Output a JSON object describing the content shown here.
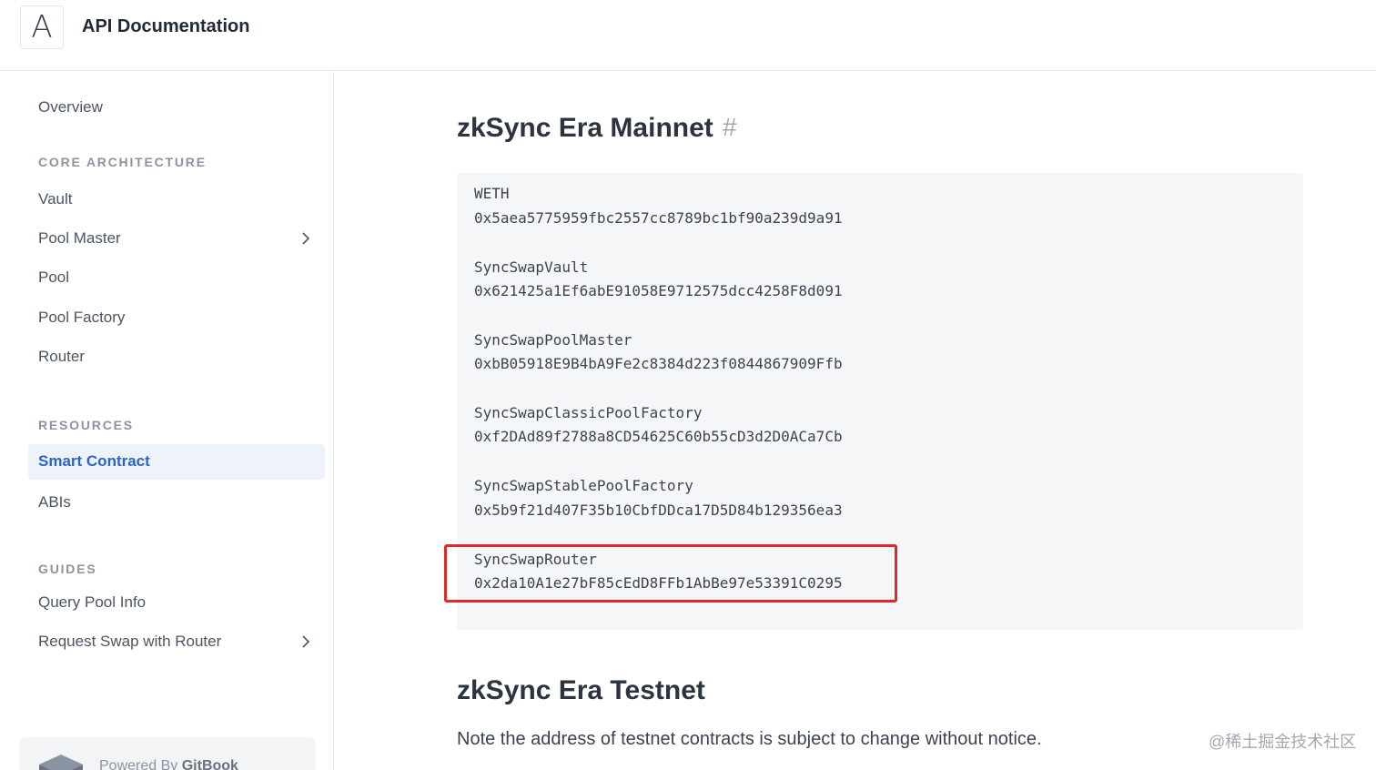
{
  "header": {
    "logo_letter": "A",
    "title": "API Documentation"
  },
  "sidebar": {
    "overview": "Overview",
    "sections": [
      {
        "title": "CORE ARCHITECTURE"
      },
      {
        "title": "RESOURCES"
      },
      {
        "title": "GUIDES"
      }
    ],
    "items": {
      "vault": "Vault",
      "pool_master": "Pool Master",
      "pool": "Pool",
      "pool_factory": "Pool Factory",
      "router": "Router",
      "smart_contract": "Smart Contract",
      "abis": "ABIs",
      "query_pool_info": "Query Pool Info",
      "request_swap": "Request Swap with Router"
    },
    "powered_by_prefix": "Powered By ",
    "powered_by_brand": "GitBook"
  },
  "main": {
    "mainnet_heading": "zkSync Era Mainnet",
    "anchor_symbol": "#",
    "contracts": [
      {
        "name": "WETH",
        "address": "0x5aea5775959fbc2557cc8789bc1bf90a239d9a91"
      },
      {
        "name": "SyncSwapVault",
        "address": "0x621425a1Ef6abE91058E9712575dcc4258F8d091"
      },
      {
        "name": "SyncSwapPoolMaster",
        "address": "0xbB05918E9B4bA9Fe2c8384d223f0844867909Ffb"
      },
      {
        "name": "SyncSwapClassicPoolFactory",
        "address": "0xf2DAd89f2788a8CD54625C60b55cD3d2D0ACa7Cb"
      },
      {
        "name": "SyncSwapStablePoolFactory",
        "address": "0x5b9f21d407F35b10CbfDDca17D5D84b129356ea3"
      },
      {
        "name": "SyncSwapRouter",
        "address": "0x2da10A1e27bF85cEdD8FFb1AbBe97e53391C0295"
      }
    ],
    "testnet_heading": "zkSync Era Testnet",
    "testnet_note": "Note the address of testnet contracts is subject to change without notice."
  },
  "watermark": "@稀土掘金技术社区",
  "colors": {
    "accent": "#2b63c7",
    "active_bg": "#eef2f9",
    "highlight_border": "#e02a2a",
    "code_bg": "#f5f6f7"
  }
}
